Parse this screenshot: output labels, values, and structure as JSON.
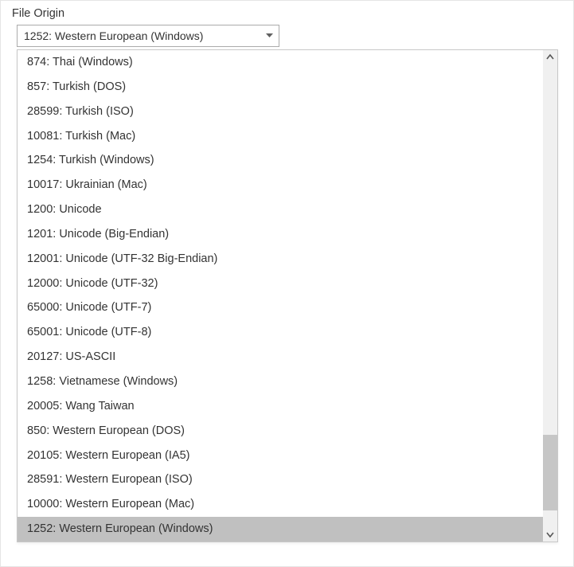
{
  "label": "File Origin",
  "selected": "1252: Western European (Windows)",
  "selectedIndex": 19,
  "options": [
    "874: Thai (Windows)",
    "857: Turkish (DOS)",
    "28599: Turkish (ISO)",
    "10081: Turkish (Mac)",
    "1254: Turkish (Windows)",
    "10017: Ukrainian (Mac)",
    "1200: Unicode",
    "1201: Unicode (Big-Endian)",
    "12001: Unicode (UTF-32 Big-Endian)",
    "12000: Unicode (UTF-32)",
    "65000: Unicode (UTF-7)",
    "65001: Unicode (UTF-8)",
    "20127: US-ASCII",
    "1258: Vietnamese (Windows)",
    "20005: Wang Taiwan",
    "850: Western European (DOS)",
    "20105: Western European (IA5)",
    "28591: Western European (ISO)",
    "10000: Western European (Mac)",
    "1252: Western European (Windows)"
  ]
}
